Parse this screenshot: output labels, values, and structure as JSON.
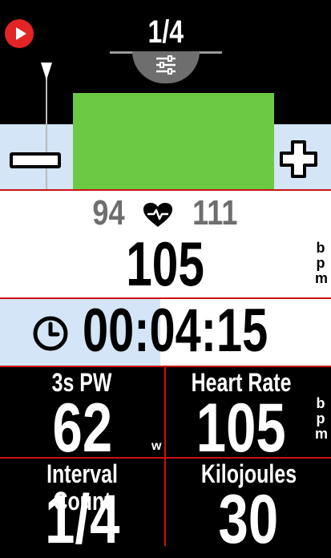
{
  "page_indicator": "1/4",
  "heart_rate": {
    "min": "94",
    "max": "111",
    "current": "105",
    "unit": "bpm"
  },
  "timer": {
    "value": "00:04:15"
  },
  "fields": [
    {
      "label": "3s PW",
      "value": "62",
      "unit": "w"
    },
    {
      "label": "Heart Rate",
      "value": "105",
      "unit": "bpm"
    },
    {
      "label": "Interval Count",
      "value": "1/4",
      "unit": ""
    },
    {
      "label": "Kilojoules",
      "value": "30",
      "unit": ""
    }
  ],
  "colors": {
    "step_block": "#6cc944",
    "control_band": "#d3e5f6",
    "separator": "#cc1111",
    "play_button": "#e32424"
  },
  "icons": {
    "play": "play-icon",
    "settings": "sliders-icon",
    "heart": "heart-icon",
    "clock": "clock-icon",
    "minus": "minus-icon",
    "plus": "plus-icon"
  }
}
